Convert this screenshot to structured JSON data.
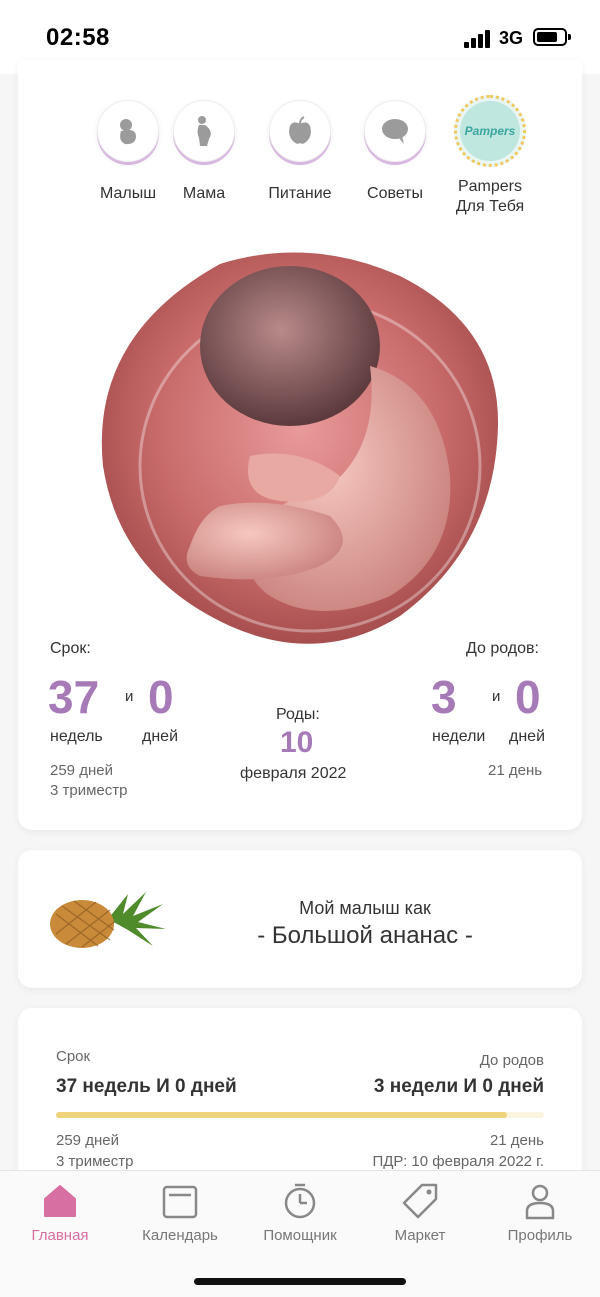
{
  "status_bar": {
    "time": "02:58",
    "network": "3G"
  },
  "categories": [
    {
      "label": "Малыш",
      "icon": "baby-icon"
    },
    {
      "label": "Мама",
      "icon": "pregnant-icon"
    },
    {
      "label": "Питание",
      "icon": "apple-icon"
    },
    {
      "label": "Советы",
      "icon": "chat-icon"
    },
    {
      "label_line1": "Pampers",
      "label_line2": "Для Тебя",
      "logo_text": "Pampers"
    }
  ],
  "stats": {
    "term_label": "Срок:",
    "weeks": "37",
    "and": "и",
    "days": "0",
    "weeks_unit": "недель",
    "days_unit": "дней",
    "total_days": "259 дней",
    "trimester": "3 триместр",
    "birth_label": "Роды:",
    "birth_day": "10",
    "birth_month_year": "февраля 2022",
    "until_label": "До родов:",
    "until_weeks": "3",
    "until_days": "0",
    "until_weeks_unit": "недели",
    "until_days_unit": "дней",
    "until_total_days": "21 день"
  },
  "fruit": {
    "title": "Мой малыш как",
    "name": "- Большой ананас -"
  },
  "progress": {
    "left_label": "Срок",
    "left_value": "37 недель И 0 дней",
    "right_label": "До родов",
    "right_value": "3 недели И 0 дней",
    "fraction": 0.925,
    "left_days": "259 дней",
    "left_trimester": "3 триместр",
    "right_days": "21 день",
    "right_due": "ПДР: 10 февраля 2022 г.",
    "bar_color": "#efd27c"
  },
  "tabs": [
    {
      "label": "Главная",
      "icon": "home-icon",
      "active": true
    },
    {
      "label": "Календарь",
      "icon": "calendar-icon"
    },
    {
      "label": "Помощник",
      "icon": "timer-icon"
    },
    {
      "label": "Маркет",
      "icon": "tag-icon"
    },
    {
      "label": "Профиль",
      "icon": "profile-icon"
    }
  ],
  "colors": {
    "accent": "#a67ab7",
    "tab_active": "#d86fa2"
  }
}
